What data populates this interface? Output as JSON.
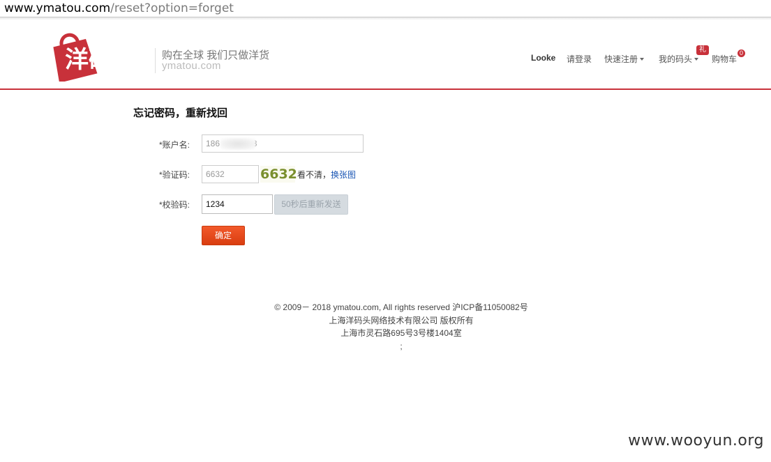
{
  "browser": {
    "url_host": "www.ymatou.com",
    "url_path": "/reset?option=forget"
  },
  "header": {
    "logo_text": "洋码头",
    "slogan": "购在全球 我们只做洋货",
    "sitename": "ymatou.com",
    "nav": {
      "user": "Looke",
      "login": "请登录",
      "register": "快速注册",
      "mine": "我的码头",
      "gift_badge": "礼",
      "cart": "购物车",
      "cart_count": "0"
    }
  },
  "form": {
    "title": "忘记密码，重新找回",
    "account_label": "*账户名:",
    "account_value": "186              3",
    "captcha_label": "*验证码:",
    "captcha_value": "6632",
    "captcha_image_text": "6632",
    "captcha_unclear": "看不清，",
    "captcha_refresh": "换张图",
    "verify_label": "*校验码:",
    "verify_value": "1234",
    "resend_label": "50秒后重新发送",
    "submit_label": "确定"
  },
  "footer": {
    "copyright": "© 2009－ 2018 ymatou.com, All rights reserved 沪ICP备11050082号",
    "company": "上海洋码头网络技术有限公司 版权所有",
    "address": "上海市灵石路695号3号楼1404室",
    "extra": ";"
  },
  "watermark": "www.wooyun.org",
  "colors": {
    "brand_red": "#c8313a",
    "submit_orange": "#e8491b",
    "link_blue": "#1a56b4"
  },
  "icons": [
    "shopping-bag-logo-icon",
    "caret-down-icon"
  ]
}
